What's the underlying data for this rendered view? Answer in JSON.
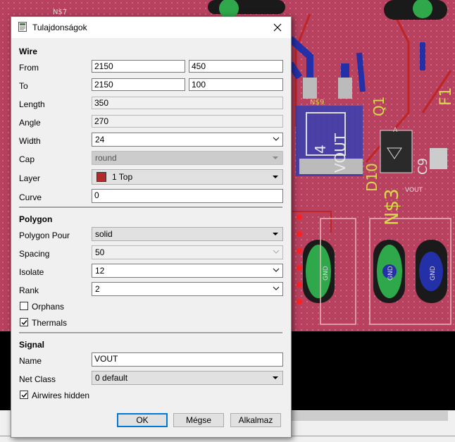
{
  "pcb": {
    "labels": [
      "N$7",
      "Q1",
      "F1",
      "N$9",
      "D10",
      "N$3",
      "VOUT",
      "4",
      "C9",
      "A",
      "VOUT",
      "GND",
      "GND",
      "GND"
    ]
  },
  "dialog": {
    "title": "Tulajdonságok",
    "sections": {
      "wire": "Wire",
      "polygon": "Polygon",
      "signal": "Signal"
    },
    "wire": {
      "from_label": "From",
      "from_x": "2150",
      "from_y": "450",
      "to_label": "To",
      "to_x": "2150",
      "to_y": "100",
      "length_label": "Length",
      "length": "350",
      "angle_label": "Angle",
      "angle": "270",
      "width_label": "Width",
      "width": "24",
      "cap_label": "Cap",
      "cap": "round",
      "layer_label": "Layer",
      "layer": "1 Top",
      "layer_color": "#b22a2a",
      "curve_label": "Curve",
      "curve": "0"
    },
    "polygon": {
      "pour_label": "Polygon Pour",
      "pour": "solid",
      "spacing_label": "Spacing",
      "spacing": "50",
      "isolate_label": "Isolate",
      "isolate": "12",
      "rank_label": "Rank",
      "rank": "2",
      "orphans_label": "Orphans",
      "orphans_checked": false,
      "thermals_label": "Thermals",
      "thermals_checked": true
    },
    "signal": {
      "name_label": "Name",
      "name": "VOUT",
      "netclass_label": "Net Class",
      "netclass": "0 default",
      "airwires_label": "Airwires hidden",
      "airwires_checked": true
    },
    "buttons": {
      "ok": "OK",
      "cancel": "Mégse",
      "apply": "Alkalmaz"
    }
  }
}
